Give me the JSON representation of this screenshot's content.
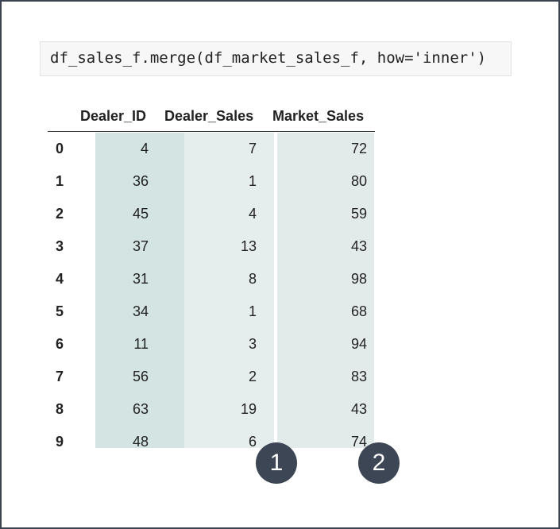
{
  "code": "df_sales_f.merge(df_market_sales_f, how='inner')",
  "table": {
    "columns": [
      "Dealer_ID",
      "Dealer_Sales",
      "Market_Sales"
    ],
    "rows": [
      {
        "index": "0",
        "values": [
          "4",
          "7",
          "72"
        ]
      },
      {
        "index": "1",
        "values": [
          "36",
          "1",
          "80"
        ]
      },
      {
        "index": "2",
        "values": [
          "45",
          "4",
          "59"
        ]
      },
      {
        "index": "3",
        "values": [
          "37",
          "13",
          "43"
        ]
      },
      {
        "index": "4",
        "values": [
          "31",
          "8",
          "98"
        ]
      },
      {
        "index": "5",
        "values": [
          "34",
          "1",
          "68"
        ]
      },
      {
        "index": "6",
        "values": [
          "11",
          "3",
          "94"
        ]
      },
      {
        "index": "7",
        "values": [
          "56",
          "2",
          "83"
        ]
      },
      {
        "index": "8",
        "values": [
          "63",
          "19",
          "43"
        ]
      },
      {
        "index": "9",
        "values": [
          "48",
          "6",
          "74"
        ]
      }
    ]
  },
  "callouts": [
    "1",
    "2"
  ],
  "colors": {
    "frame": "#3b4350",
    "callout": "#3d4654",
    "col_dealer_id": "#d3e4e3",
    "col_dealer_sales": "#e6eeed",
    "col_market_sales": "#e3ebea"
  }
}
